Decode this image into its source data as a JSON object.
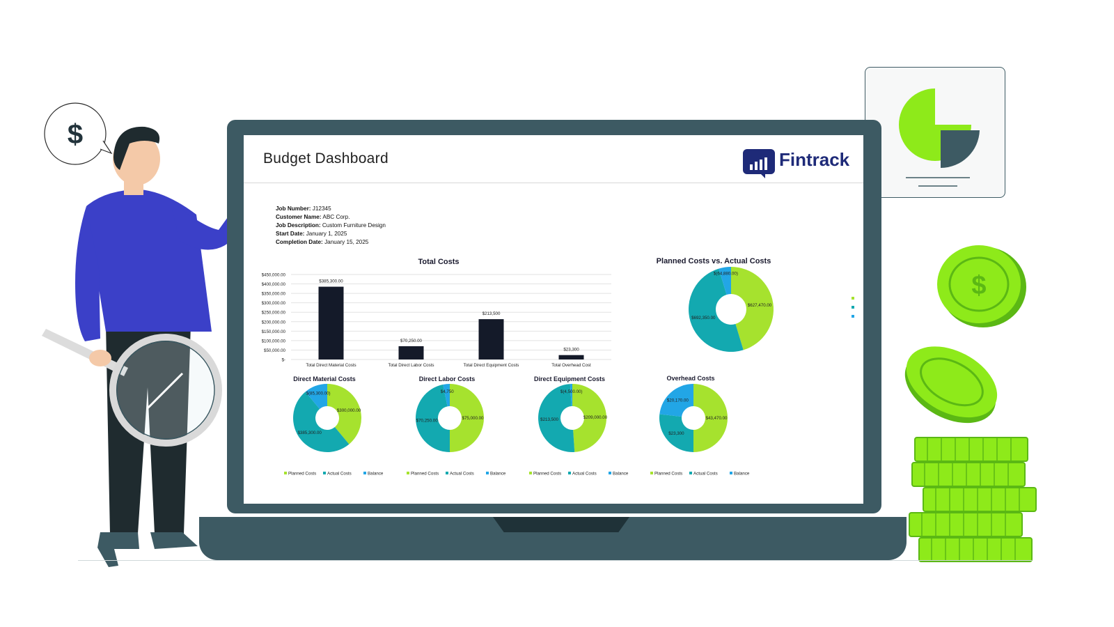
{
  "dashboard": {
    "title": "Budget Dashboard",
    "brand": "Fintrack",
    "job": [
      {
        "label": "Job Number:",
        "value": "J12345"
      },
      {
        "label": "Customer Name:",
        "value": "ABC Corp."
      },
      {
        "label": "Job Description:",
        "value": "Custom Furniture Design"
      },
      {
        "label": "Start Date:",
        "value": "January 1, 2025"
      },
      {
        "label": "Completion Date:",
        "value": "January 15, 2025"
      }
    ]
  },
  "colors": {
    "planned": "#a6e22e",
    "actual": "#13a9b0",
    "balance": "#22a6e6",
    "bar": "#141a29",
    "laptop": "#3d5a63",
    "coin": "#8eea1a",
    "brand": "#1e2a78"
  },
  "decor": {
    "speech_icon": "dollar-sign-icon",
    "speech_symbol": "$"
  },
  "chart_data": [
    {
      "type": "bar",
      "title": "Total Costs",
      "categories": [
        "Total Direct Material Costs",
        "Total Direct Labor Costs",
        "Total Direct Equipment Costs",
        "Total Overhead Cost"
      ],
      "values": [
        385300,
        70250,
        213500,
        23300
      ],
      "data_labels": [
        "$385,300.00",
        "$70,250.00",
        "$213,500",
        "$23,300"
      ],
      "ylim": [
        0,
        450000
      ],
      "yticks": [
        0,
        50000,
        100000,
        150000,
        200000,
        250000,
        300000,
        350000,
        400000,
        450000
      ],
      "ytick_labels": [
        "$-",
        "$50,000.00",
        "$100,000.00",
        "$150,000.00",
        "$200,000.00",
        "$250,000.00",
        "$300,000.00",
        "$350,000.00",
        "$400,000.00",
        "$450,000.00"
      ],
      "grid": true
    },
    {
      "type": "pie",
      "title": "Planned Costs vs. Actual Costs",
      "labels": [
        "Planned Costs",
        "Actual Costs",
        "Balance"
      ],
      "values": [
        627470,
        692350,
        64880
      ],
      "data_labels": [
        "$627,470.00",
        "$692,350.00",
        "$(64,880.00)"
      ],
      "legend": "right"
    },
    {
      "type": "pie",
      "title": "Direct Material Costs",
      "labels": [
        "Planned Costs",
        "Actual Costs",
        "Balance"
      ],
      "values": [
        300000,
        385300,
        85300
      ],
      "data_labels": [
        "$300,000.00",
        "$385,300.00",
        "$(85,300.00)"
      ],
      "legend": "bottom"
    },
    {
      "type": "pie",
      "title": "Direct Labor Costs",
      "labels": [
        "Planned Costs",
        "Actual Costs",
        "Balance"
      ],
      "values": [
        75000,
        70250,
        4750
      ],
      "data_labels": [
        "$75,000.00",
        "$70,250.00",
        "$4,750"
      ],
      "legend": "bottom"
    },
    {
      "type": "pie",
      "title": "Direct Equipment Costs",
      "labels": [
        "Planned Costs",
        "Actual Costs",
        "Balance"
      ],
      "values": [
        209000,
        213500,
        4500
      ],
      "data_labels": [
        "$209,000.00",
        "$213,500",
        "$(4,500.00)"
      ],
      "legend": "bottom"
    },
    {
      "type": "pie",
      "title": "Overhead Costs",
      "labels": [
        "Planned Costs",
        "Actual Costs",
        "Balance"
      ],
      "values": [
        43470,
        23300,
        20170
      ],
      "data_labels": [
        "$43,470.00",
        "$23,300",
        "$20,170.00"
      ],
      "legend": "bottom"
    }
  ]
}
